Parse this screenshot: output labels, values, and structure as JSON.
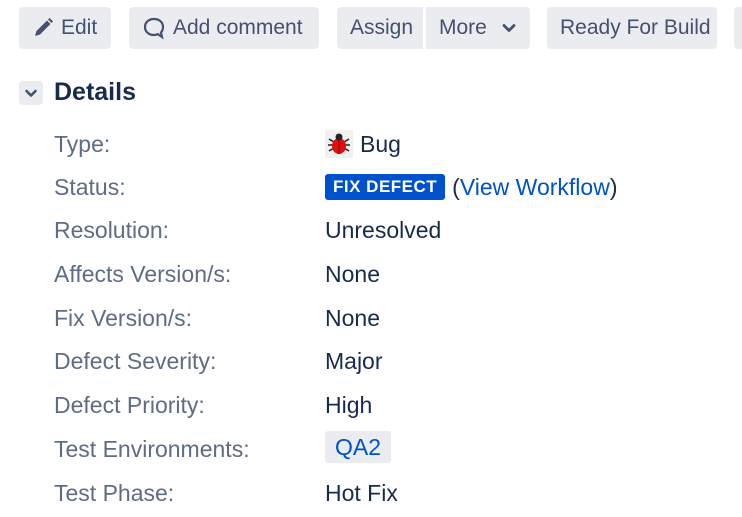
{
  "toolbar": {
    "edit_label": "Edit",
    "comment_label": "Add comment",
    "assign_label": "Assign",
    "more_label": "More",
    "ready_label": "Ready For Build"
  },
  "details": {
    "title": "Details",
    "fields": {
      "type": {
        "label": "Type:",
        "value": "Bug",
        "icon": "bug-icon"
      },
      "status": {
        "label": "Status:",
        "value": "FIX DEFECT",
        "link_open": "(",
        "link": "View Workflow",
        "link_close": ")",
        "lozenge_color": "#0052cc"
      },
      "resolution": {
        "label": "Resolution:",
        "value": "Unresolved"
      },
      "affects_version": {
        "label": "Affects Version/s:",
        "value": "None"
      },
      "fix_version": {
        "label": "Fix Version/s:",
        "value": "None"
      },
      "defect_severity": {
        "label": "Defect Severity:",
        "value": "Major"
      },
      "defect_priority": {
        "label": "Defect Priority:",
        "value": "High"
      },
      "test_environments": {
        "label": "Test Environments:",
        "value": "QA2"
      },
      "test_phase": {
        "label": "Test Phase:",
        "value": "Hot Fix"
      }
    }
  },
  "colors": {
    "accent": "#0052cc",
    "button_bg": "#ebecf0",
    "label": "#5e6c84",
    "text": "#172b4d"
  }
}
